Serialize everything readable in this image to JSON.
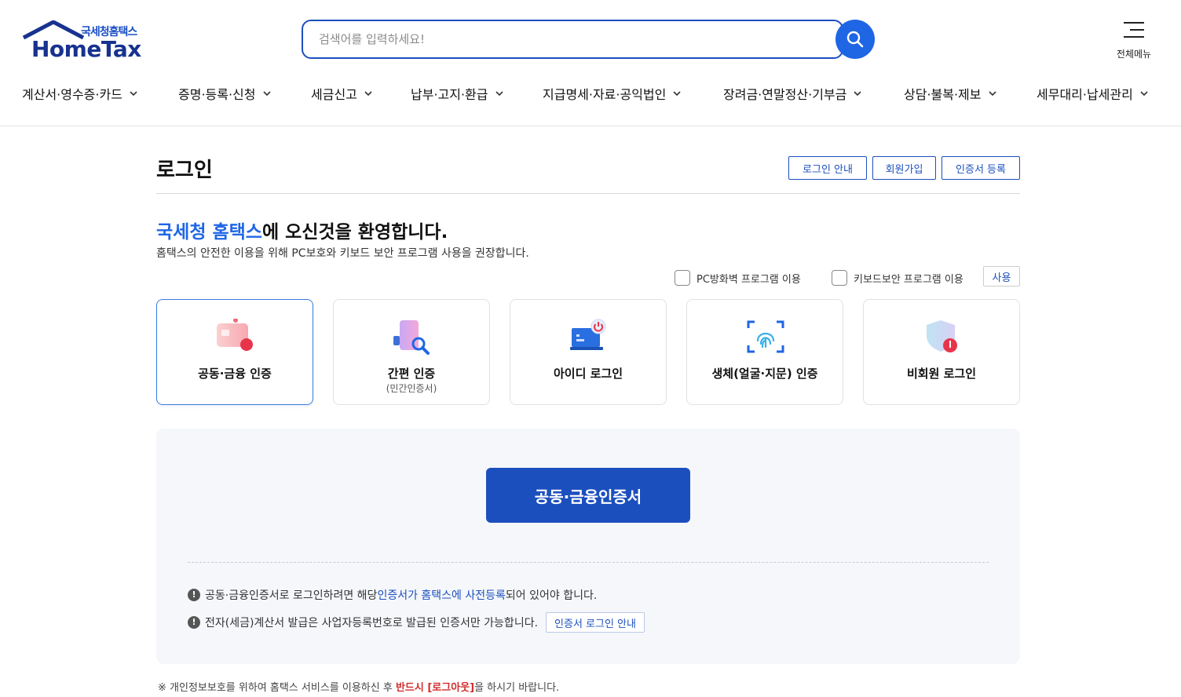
{
  "header": {
    "logo_kor": "국세청홈택스",
    "logo_eng": "HomeTax",
    "search_placeholder": "검색어를 입력하세요!",
    "all_menu_label": "전체메뉴"
  },
  "gnb": [
    "계산서·영수증·카드",
    "증명·등록·신청",
    "세금신고",
    "납부·고지·환급",
    "지급명세·자료·공익법인",
    "장려금·연말정산·기부금",
    "상담·불복·제보",
    "세무대리·납세관리"
  ],
  "main": {
    "title": "로그인",
    "top_buttons": [
      "로그인 안내",
      "회원가입",
      "인증서 등록"
    ],
    "welcome_highlight": "국세청 홈택스",
    "welcome_rest": "에 오신것을 환영합니다.",
    "notice": "홈택스의 안전한 이용을 위해 PC보호와 키보드 보안 프로그램 사용을 권장합니다.",
    "check_pc": "PC방화벽 프로그램 이용",
    "check_keyboard": "키보드보안 프로그램 이용",
    "use_button": "사용",
    "login_methods": [
      {
        "label": "공동·금융 인증",
        "sub": "",
        "icon": "certificate-card-icon",
        "active": true
      },
      {
        "label": "간편 인증",
        "sub": "(민간인증서)",
        "icon": "phone-magnifier-icon",
        "active": false
      },
      {
        "label": "아이디 로그인",
        "sub": "",
        "icon": "laptop-power-icon",
        "active": false
      },
      {
        "label": "생체(얼굴·지문) 인증",
        "sub": "",
        "icon": "fingerprint-icon",
        "active": false
      },
      {
        "label": "비회원 로그인",
        "sub": "",
        "icon": "shield-user-icon",
        "active": false
      }
    ],
    "panel": {
      "primary_button": "공동·금융인증서",
      "info1_pre": "공동·금융인증서로 로그인하려면 해당 ",
      "info1_link": "인증서가 홈택스에 사전등록",
      "info1_post": "되어 있어야 합니다.",
      "info2": "전자(세금)계산서 발급은 사업자등록번호로 발급된 인증서만 가능합니다.",
      "info2_button": "인증서 로그인 안내"
    },
    "footnote_pre": "※ 개인정보보호를 위하여 홈택스 서비스를 이용하신 후 ",
    "footnote_red": "반드시 [로그아웃]",
    "footnote_post": "을 하시기 바랍니다."
  },
  "colors": {
    "primary": "#1c4fbe",
    "accent": "#1f66e5",
    "panel_bg": "#f5f7fb",
    "warning_red": "#d12d2d"
  }
}
